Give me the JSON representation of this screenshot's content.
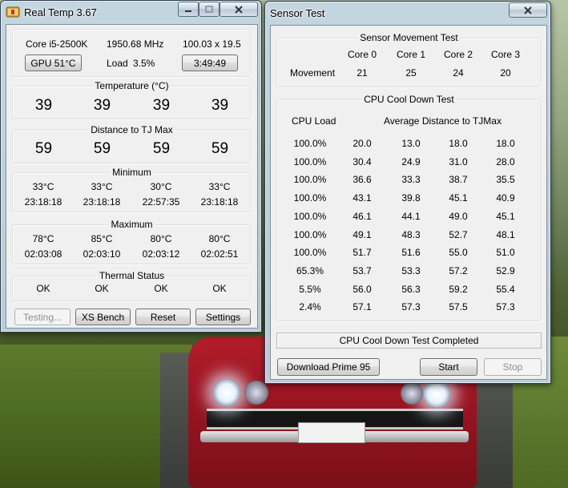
{
  "realtemp": {
    "title": "Real Temp 3.67",
    "cpu_model": "Core i5-2500K",
    "cpu_clock": "1950.68 MHz",
    "multiplier": "100.03 x 19.5",
    "gpu_button": "GPU  51°C",
    "load_label": "Load",
    "load_value": "3.5%",
    "timer_button": "3:49:49",
    "temperature": {
      "label": "Temperature (°C)",
      "values": [
        "39",
        "39",
        "39",
        "39"
      ]
    },
    "distance": {
      "label": "Distance to TJ Max",
      "values": [
        "59",
        "59",
        "59",
        "59"
      ]
    },
    "minimum": {
      "label": "Minimum",
      "temps": [
        "33°C",
        "33°C",
        "30°C",
        "33°C"
      ],
      "times": [
        "23:18:18",
        "23:18:18",
        "22:57:35",
        "23:18:18"
      ]
    },
    "maximum": {
      "label": "Maximum",
      "temps": [
        "78°C",
        "85°C",
        "80°C",
        "80°C"
      ],
      "times": [
        "02:03:08",
        "02:03:10",
        "02:03:12",
        "02:02:51"
      ]
    },
    "thermal": {
      "label": "Thermal Status",
      "values": [
        "OK",
        "OK",
        "OK",
        "OK"
      ]
    },
    "buttons": {
      "testing": "Testing...",
      "xs_bench": "XS Bench",
      "reset": "Reset",
      "settings": "Settings"
    }
  },
  "sensortest": {
    "title": "Sensor Test",
    "movement": {
      "label": "Sensor Movement Test",
      "cores": [
        "Core 0",
        "Core 1",
        "Core 2",
        "Core 3"
      ],
      "row_label": "Movement",
      "values": [
        "21",
        "25",
        "24",
        "20"
      ]
    },
    "cooldown": {
      "label": "CPU Cool Down Test",
      "col_load": "CPU Load",
      "col_avg": "Average Distance to TJMax",
      "rows": [
        {
          "load": "100.0%",
          "c": [
            "20.0",
            "13.0",
            "18.0",
            "18.0"
          ]
        },
        {
          "load": "100.0%",
          "c": [
            "30.4",
            "24.9",
            "31.0",
            "28.0"
          ]
        },
        {
          "load": "100.0%",
          "c": [
            "36.6",
            "33.3",
            "38.7",
            "35.5"
          ]
        },
        {
          "load": "100.0%",
          "c": [
            "43.1",
            "39.8",
            "45.1",
            "40.9"
          ]
        },
        {
          "load": "100.0%",
          "c": [
            "46.1",
            "44.1",
            "49.0",
            "45.1"
          ]
        },
        {
          "load": "100.0%",
          "c": [
            "49.1",
            "48.3",
            "52.7",
            "48.1"
          ]
        },
        {
          "load": "100.0%",
          "c": [
            "51.7",
            "51.6",
            "55.0",
            "51.0"
          ]
        },
        {
          "load": "65.3%",
          "c": [
            "53.7",
            "53.3",
            "57.2",
            "52.9"
          ]
        },
        {
          "load": "5.5%",
          "c": [
            "56.0",
            "56.3",
            "59.2",
            "55.4"
          ]
        },
        {
          "load": "2.4%",
          "c": [
            "57.1",
            "57.3",
            "57.5",
            "57.3"
          ]
        }
      ]
    },
    "status": "CPU Cool Down Test Completed",
    "buttons": {
      "prime": "Download Prime 95",
      "start": "Start",
      "stop": "Stop"
    }
  },
  "icons": {
    "app": "thermometer-icon",
    "minimize": "minimize-icon",
    "maximize": "maximize-icon",
    "close": "close-icon"
  }
}
